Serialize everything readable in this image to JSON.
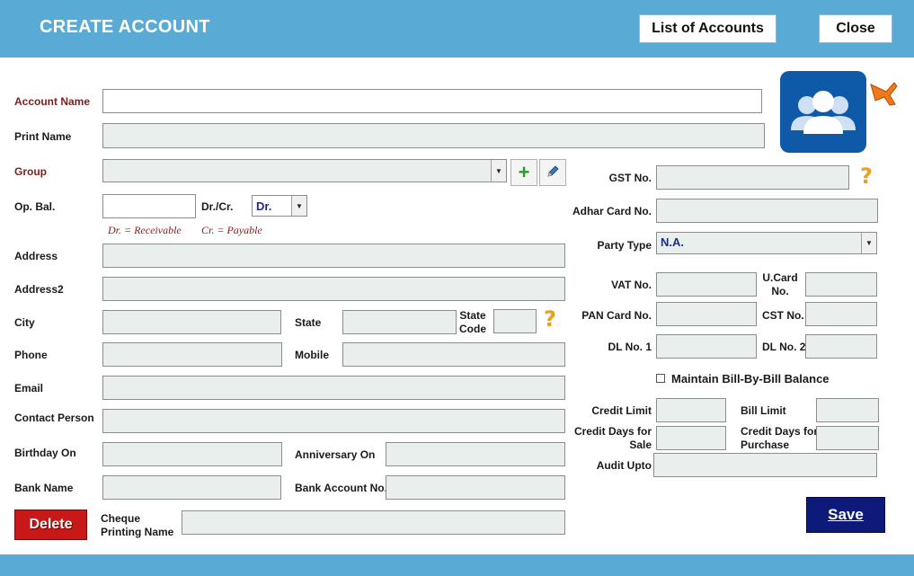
{
  "header": {
    "title": "CREATE ACCOUNT",
    "list_button": "List of Accounts",
    "close_button": "Close"
  },
  "left": {
    "account_name": {
      "label": "Account Name",
      "value": ""
    },
    "print_name": {
      "label": "Print Name",
      "value": ""
    },
    "group": {
      "label": "Group",
      "value": ""
    },
    "op_bal": {
      "label": "Op. Bal.",
      "value": "",
      "drcr_label": "Dr./Cr.",
      "drcr_value": "Dr."
    },
    "hint_dr": "Dr. = Receivable",
    "hint_cr": "Cr. = Payable",
    "address": {
      "label": "Address",
      "value": ""
    },
    "address2": {
      "label": "Address2",
      "value": ""
    },
    "city": {
      "label": "City",
      "value": ""
    },
    "state": {
      "label": "State",
      "value": ""
    },
    "state_code": {
      "label_line1": "State",
      "label_line2": "Code",
      "value": ""
    },
    "phone": {
      "label": "Phone",
      "value": ""
    },
    "mobile": {
      "label": "Mobile",
      "value": ""
    },
    "email": {
      "label": "Email",
      "value": ""
    },
    "contact_person": {
      "label": "Contact Person",
      "value": ""
    },
    "birthday": {
      "label": "Birthday On",
      "value": ""
    },
    "anniversary": {
      "label": "Anniversary On",
      "value": ""
    },
    "bank_name": {
      "label": "Bank Name",
      "value": ""
    },
    "bank_account": {
      "label": "Bank Account No.",
      "value": ""
    },
    "cheque_name": {
      "label_line1": "Cheque",
      "label_line2": "Printing Name",
      "value": ""
    },
    "delete_button": "Delete"
  },
  "right": {
    "gst": {
      "label": "GST No.",
      "value": ""
    },
    "adhar": {
      "label": "Adhar Card No.",
      "value": ""
    },
    "party_type": {
      "label": "Party Type",
      "value": "N.A."
    },
    "vat": {
      "label": "VAT No.",
      "value": ""
    },
    "ucard": {
      "label_line1": "U.Card",
      "label_line2": "No.",
      "value": ""
    },
    "pan": {
      "label": "PAN Card No.",
      "value": ""
    },
    "cst": {
      "label": "CST No.",
      "value": ""
    },
    "dl1": {
      "label": "DL No. 1",
      "value": ""
    },
    "dl2": {
      "label": "DL No. 2",
      "value": ""
    },
    "maintain_bill": {
      "label": "Maintain Bill-By-Bill Balance",
      "checked": false
    },
    "credit_limit": {
      "label": "Credit Limit",
      "value": ""
    },
    "bill_limit": {
      "label": "Bill Limit",
      "value": ""
    },
    "credit_days_sale": {
      "label_line1": "Credit Days for",
      "label_line2": "Sale",
      "value": ""
    },
    "credit_days_purchase": {
      "label_line1": "Credit Days for",
      "label_line2": "Purchase",
      "value": ""
    },
    "audit_upto": {
      "label": "Audit Upto",
      "value": ""
    },
    "save_button": "Save"
  },
  "colors": {
    "header": "#5aaad6",
    "field": "#e8efed",
    "save": "#0d1a7a",
    "delete": "#c81818",
    "label_red": "#7f1d1d"
  },
  "icons": [
    "users-group-icon",
    "pin-arrow-icon",
    "plus-icon",
    "pencil-icon",
    "help-question-icon",
    "dropdown-arrow-icon"
  ]
}
